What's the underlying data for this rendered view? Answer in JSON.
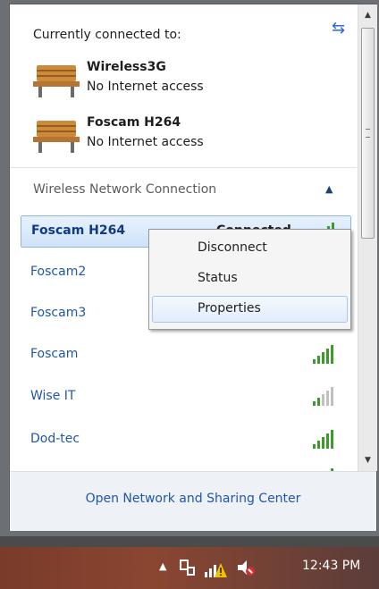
{
  "flyout": {
    "heading": "Currently connected to:",
    "connections": [
      {
        "name": "Wireless3G",
        "status": "No Internet access"
      },
      {
        "name": "Foscam H264",
        "status": "No Internet access"
      }
    ],
    "section_title": "Wireless Network Connection",
    "networks": [
      {
        "name": "Foscam H264",
        "status": "Connected",
        "selected": true,
        "signal_bars": 5
      },
      {
        "name": "Foscam2",
        "status": "",
        "selected": false,
        "signal_bars": 0
      },
      {
        "name": "Foscam3",
        "status": "",
        "selected": false,
        "signal_bars": 0
      },
      {
        "name": "Foscam",
        "status": "",
        "selected": false,
        "signal_bars": 5
      },
      {
        "name": "Wise IT",
        "status": "",
        "selected": false,
        "signal_bars": 2
      },
      {
        "name": "Dod-tec",
        "status": "",
        "selected": false,
        "signal_bars": 5
      }
    ],
    "footer_link": "Open Network and Sharing Center"
  },
  "context_menu": {
    "items": [
      "Disconnect",
      "Status",
      "Properties"
    ],
    "highlighted": "Properties"
  },
  "taskbar": {
    "clock": "12:43 PM"
  },
  "colors": {
    "link": "#1f57a8",
    "signal_active": "#3e9a2c",
    "signal_inactive": "#c0c0c0",
    "warning": "#f2c200",
    "mute": "#d32f2f"
  },
  "icons": {
    "refresh": "refresh-icon",
    "bench": "network-bench-icon",
    "collapse": "chevron-up-icon",
    "signal": "wifi-signal-icon",
    "tray_arrow": "show-hidden-icons-icon",
    "tray_network": "network-adapter-icon",
    "volume": "volume-muted-icon"
  }
}
